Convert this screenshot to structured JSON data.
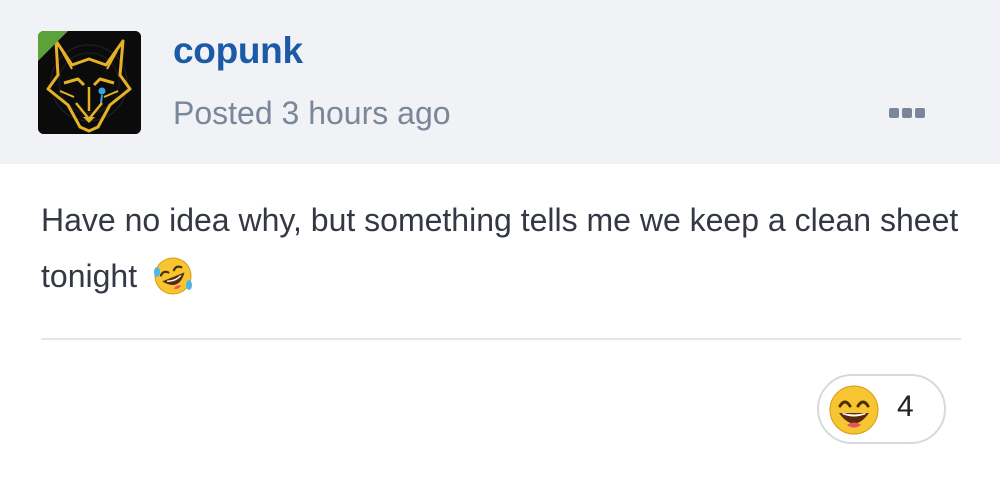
{
  "author": {
    "name": "copunk",
    "avatar_icon": "wolf-avatar-icon",
    "online_badge_color": "#5ba23a"
  },
  "meta": {
    "posted": "Posted 3 hours ago"
  },
  "actions": {
    "more_icon": "ellipsis-icon"
  },
  "post": {
    "text": "Have no idea why, but something tells me we keep a clean sheet tonight",
    "inline_emoji": "rolling-on-floor-laughing-emoji"
  },
  "reactions": [
    {
      "icon": "grinning-face-emoji",
      "count": "4"
    }
  ],
  "colors": {
    "author_link": "#1b5aa6",
    "meta_text": "#7a869a",
    "header_bg": "#f1f2f5",
    "body_text": "#333844"
  }
}
